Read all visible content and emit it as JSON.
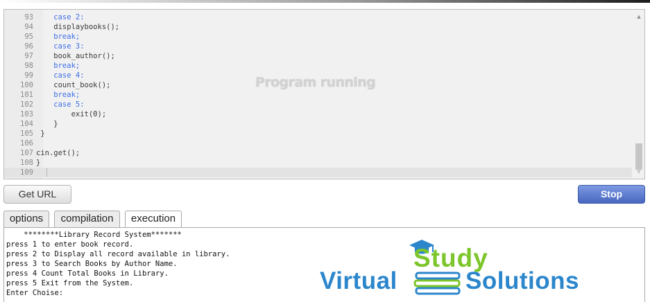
{
  "editor": {
    "lines": [
      {
        "num": "93",
        "code": "    case 2:",
        "kw": true
      },
      {
        "num": "94",
        "code": "    displaybooks();",
        "kw": false
      },
      {
        "num": "95",
        "code": "    break;",
        "kw": true
      },
      {
        "num": "96",
        "code": "    case 3:",
        "kw": true
      },
      {
        "num": "97",
        "code": "    book_author();",
        "kw": false
      },
      {
        "num": "98",
        "code": "    break;",
        "kw": true
      },
      {
        "num": "99",
        "code": "    case 4:",
        "kw": true
      },
      {
        "num": "100",
        "code": "    count_book();",
        "kw": false
      },
      {
        "num": "101",
        "code": "    break;",
        "kw": true
      },
      {
        "num": "102",
        "code": "    case 5:",
        "kw": true
      },
      {
        "num": "103",
        "code": "        exit(0);",
        "kw": false
      },
      {
        "num": "104",
        "code": "    }",
        "kw": false
      },
      {
        "num": "105",
        "code": " }",
        "kw": false
      },
      {
        "num": "106",
        "code": "",
        "kw": false
      },
      {
        "num": "107",
        "code": "cin.get();",
        "kw": false
      },
      {
        "num": "108",
        "code": "}",
        "kw": false
      },
      {
        "num": "109",
        "code": "",
        "kw": false
      }
    ],
    "status_overlay": "Program running",
    "scroll_up_icon": "▲",
    "scroll_down_icon": "▼"
  },
  "toolbar": {
    "get_url_label": "Get URL",
    "stop_label": "Stop"
  },
  "tabs": {
    "options": "options",
    "compilation": "compilation",
    "execution": "execution",
    "active": "execution"
  },
  "console": {
    "lines": [
      "    ********Library Record System*******",
      "press 1 to enter book record.",
      "press 2 to Display all record available in library.",
      "press 3 to Search Books by Author Name.",
      "press 4 Count Total Books in Library.",
      "press 5 Exit from the System.",
      "Enter Choise:"
    ]
  },
  "logo": {
    "word_study": "Study",
    "word_virtual": "Virtual",
    "word_solutions": "Solutions",
    "icons": [
      "graduation-cap-icon",
      "book-stack-icon"
    ],
    "colors": {
      "green": "#7cc52a",
      "blue": "#2b86cc"
    }
  },
  "colors": {
    "keyword": "#3d6de6",
    "stop_button": "#5a77cf"
  }
}
